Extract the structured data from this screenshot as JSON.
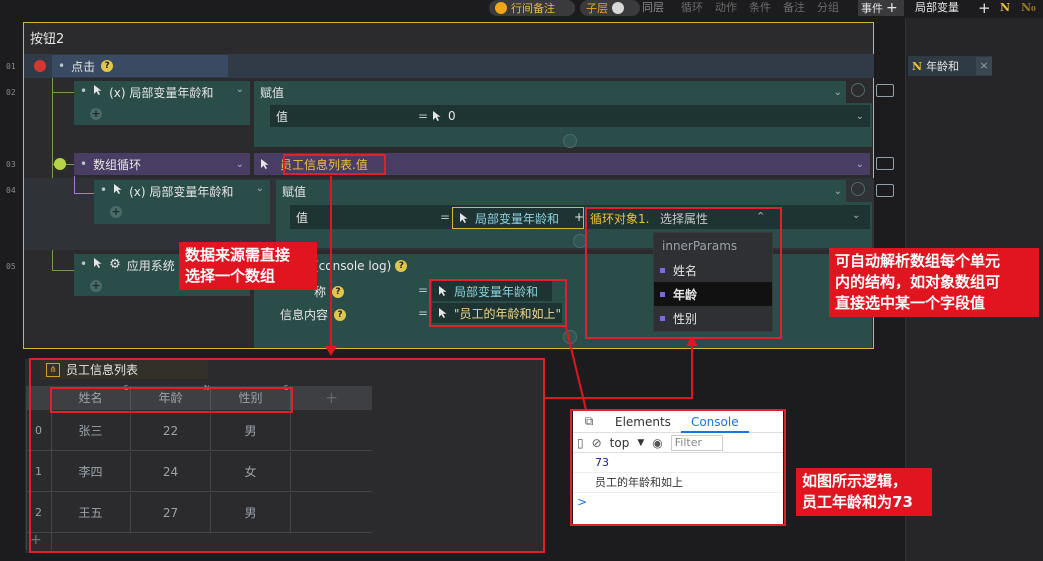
{
  "topbar": {
    "line_note": "行间备注",
    "sublayer": "子层",
    "same_layer": "同层",
    "tabs": [
      "循环",
      "动作",
      "条件",
      "备注",
      "分组"
    ],
    "event": "事件",
    "local_vars": "局部变量",
    "badge_n": "N",
    "badge_no": "N₀"
  },
  "sidebar": {
    "variable_name": "年龄和",
    "variable_type": "N"
  },
  "panel": {
    "title": "按钮2",
    "line_numbers": [
      "01",
      "02",
      "03",
      "04",
      "05"
    ]
  },
  "rows": {
    "event_click": "点击",
    "local_var_1": "(x)  局部变量年龄和",
    "assign_1": "赋值",
    "value_label": "值",
    "value_1": "0",
    "loop_label": "数组循环",
    "loop_source": "员工信息列表.值",
    "local_var_2": "(x)  局部变量年龄和",
    "assign_2": "赋值",
    "value_label_2": "值",
    "value_2_var": "局部变量年龄和",
    "plus_sign": "+",
    "loop_object": "循环对象1.",
    "select_attr": "选择属性",
    "app_system": "应用系统",
    "console_log": "(console log)",
    "name_label": "称",
    "name_value": "局部变量年龄和",
    "info_label": "信息内容",
    "info_value": "\"员工的年龄和如上\""
  },
  "attr_dropdown": {
    "header": "innerParams",
    "items": [
      "姓名",
      "年龄",
      "性别"
    ],
    "selected": "年龄"
  },
  "callouts": {
    "left": "数据来源需直接\n选择一个数组",
    "right": "可自动解析数组每个单元\n内的结构，如对象数组可\n直接选中某一个字段值",
    "bottom": "如图所示逻辑，\n员工年龄和为73"
  },
  "table": {
    "title": "员工信息列表",
    "columns": [
      "姓名",
      "年龄",
      "性别"
    ],
    "column_types": [
      "S",
      "N",
      "S"
    ],
    "rows": [
      {
        "index": "0",
        "cells": [
          "张三",
          "22",
          "男"
        ]
      },
      {
        "index": "1",
        "cells": [
          "李四",
          "24",
          "女"
        ]
      },
      {
        "index": "2",
        "cells": [
          "王五",
          "27",
          "男"
        ]
      }
    ],
    "add_row": "+"
  },
  "devtools": {
    "tabs": [
      "Elements",
      "Console"
    ],
    "active_tab": "Console",
    "context": "top",
    "filter_placeholder": "Filter",
    "output": [
      "73",
      "员工的年龄和如上"
    ],
    "prompt": ">"
  },
  "colors": {
    "accent_red": "#e01520",
    "panel_border": "#d8b53a",
    "teal_block": "#2b4d4a",
    "purple_block": "#4a3d63"
  }
}
